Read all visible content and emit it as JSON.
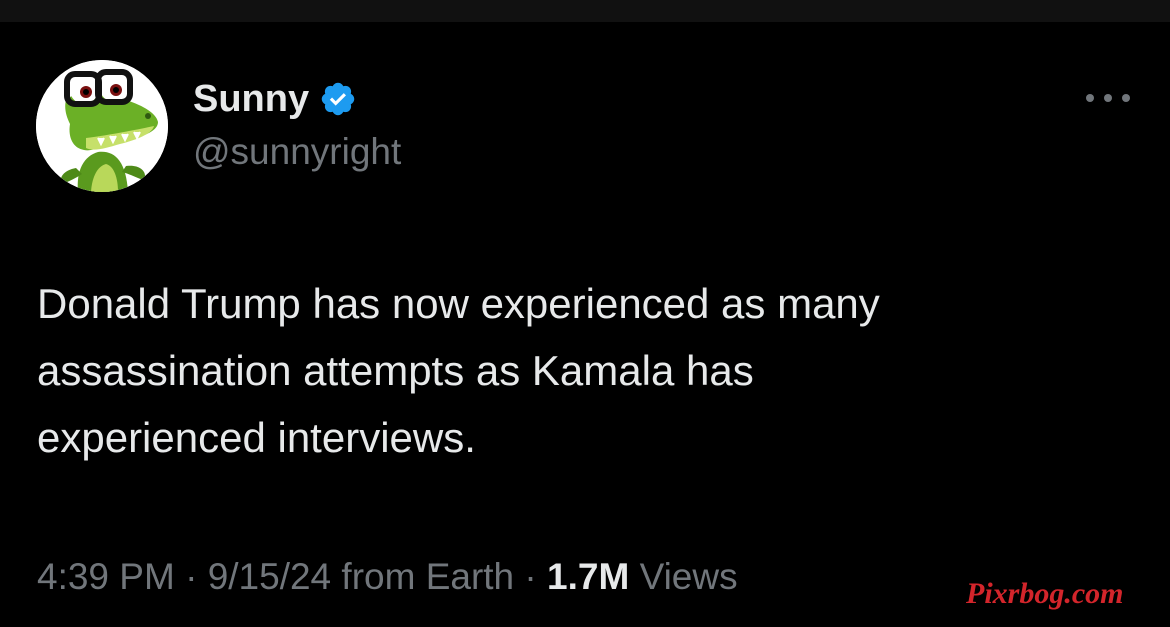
{
  "author": {
    "display_name": "Sunny",
    "handle": "@sunnyright",
    "verified": true,
    "verified_color": "#1d9bf0",
    "avatar_icon": "crocodile-with-glasses-avatar"
  },
  "menu": {
    "more_icon": "more-dots-icon"
  },
  "tweet": {
    "lines": [
      "Donald Trump has now experienced as many",
      "assassination attempts as Kamala has",
      "experienced interviews."
    ]
  },
  "meta": {
    "time": "4:39 PM",
    "separator": "·",
    "date": "9/15/24",
    "source": "from Earth",
    "views_count": "1.7M",
    "views_label": "Views"
  },
  "watermark": {
    "text": "Pixrbog.com",
    "color": "#d3252b"
  },
  "colors": {
    "background": "#000000",
    "primary_text": "#e7e9ea",
    "secondary_text": "#71767b"
  }
}
